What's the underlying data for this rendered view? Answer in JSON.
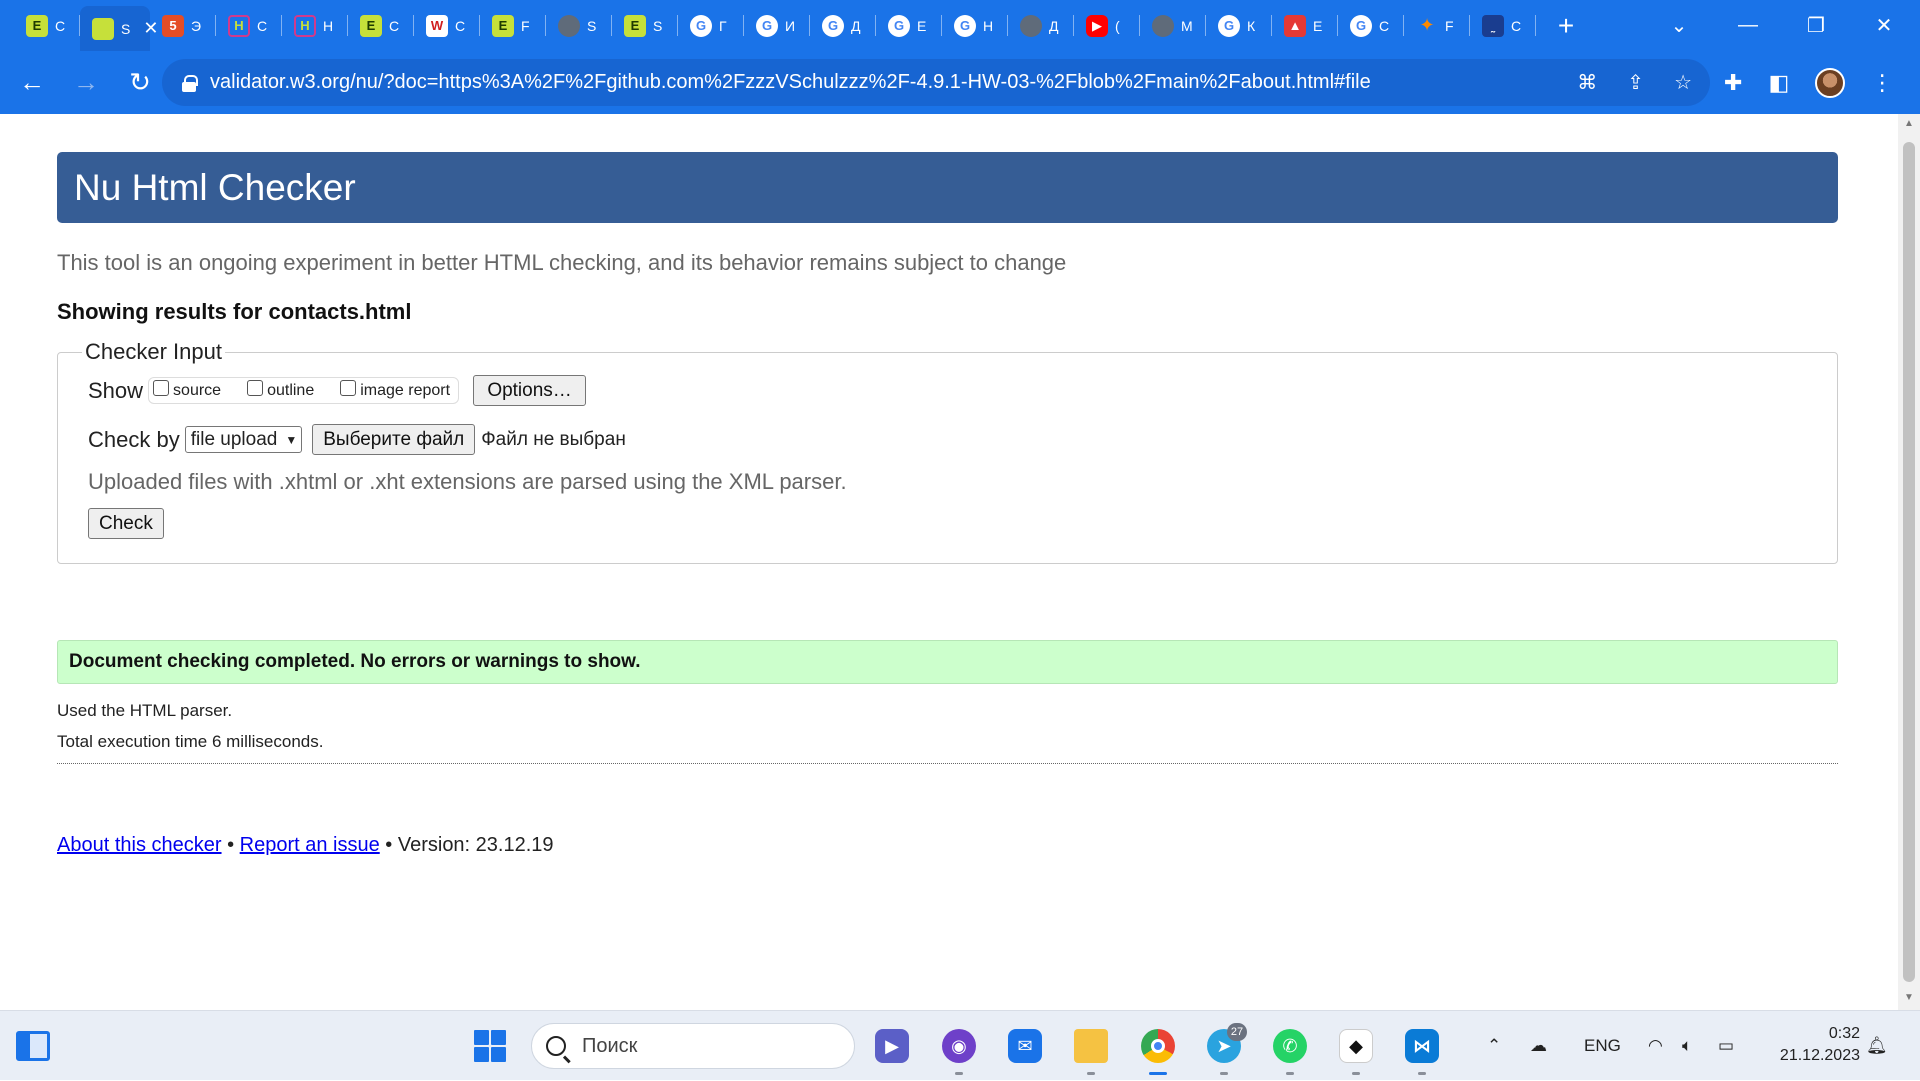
{
  "browser": {
    "tabs": [
      {
        "icon": "yellow-green-square-icon",
        "glyph": "E",
        "text": "С",
        "active": false
      },
      {
        "icon": "yellow-green-square-icon",
        "glyph": "",
        "text": "S",
        "active": true
      },
      {
        "icon": "html5-icon",
        "glyph": "5",
        "text": "Э",
        "active": false
      },
      {
        "icon": "htmlcademy-icon",
        "glyph": "H",
        "text": "С",
        "active": false
      },
      {
        "icon": "htmlcademy-icon",
        "glyph": "H",
        "text": "Н",
        "active": false
      },
      {
        "icon": "yellow-green-square-icon",
        "glyph": "E",
        "text": "С",
        "active": false
      },
      {
        "icon": "w3schools-icon",
        "glyph": "W",
        "text": "С",
        "active": false
      },
      {
        "icon": "yellow-green-square-icon",
        "glyph": "E",
        "text": "F",
        "active": false
      },
      {
        "icon": "globe-icon",
        "glyph": "",
        "text": "S",
        "active": false
      },
      {
        "icon": "yellow-green-square-icon",
        "glyph": "E",
        "text": "S",
        "active": false
      },
      {
        "icon": "google-icon",
        "glyph": "G",
        "text": "Г",
        "active": false
      },
      {
        "icon": "google-icon",
        "glyph": "G",
        "text": "И",
        "active": false
      },
      {
        "icon": "google-icon",
        "glyph": "G",
        "text": "Д",
        "active": false
      },
      {
        "icon": "google-icon",
        "glyph": "G",
        "text": "Е",
        "active": false
      },
      {
        "icon": "google-icon",
        "glyph": "G",
        "text": "Н",
        "active": false
      },
      {
        "icon": "globe-icon",
        "glyph": "",
        "text": "Д",
        "active": false
      },
      {
        "icon": "youtube-icon",
        "glyph": "▶",
        "text": "(",
        "active": false
      },
      {
        "icon": "globe-icon",
        "glyph": "",
        "text": "М",
        "active": false
      },
      {
        "icon": "google-icon",
        "glyph": "G",
        "text": "К",
        "active": false
      },
      {
        "icon": "red-profile-icon",
        "glyph": "▲",
        "text": "Е",
        "active": false
      },
      {
        "icon": "google-icon",
        "glyph": "G",
        "text": "С",
        "active": false
      },
      {
        "icon": "fox-icon",
        "glyph": "✦",
        "text": "F",
        "active": false
      },
      {
        "icon": "dark-blue-icon",
        "glyph": "˷",
        "text": "С",
        "active": false
      }
    ],
    "url": "validator.w3.org/nu/?doc=https%3A%2F%2Fgithub.com%2FzzzVSchulzzz%2F-4.9.1-HW-03-%2Fblob%2Fmain%2Fabout.html#file"
  },
  "page": {
    "title": "Nu Html Checker",
    "tagline": "This tool is an ongoing experiment in better HTML checking, and its behavior remains subject to change",
    "showing": "Showing results for contacts.html",
    "checker": {
      "legend": "Checker Input",
      "show_label": "Show",
      "options": [
        {
          "label": "source",
          "checked": false
        },
        {
          "label": "outline",
          "checked": false
        },
        {
          "label": "image report",
          "checked": false
        }
      ],
      "options_button": "Options…",
      "check_by_label": "Check by",
      "check_by_value": "file upload",
      "choose_file_button": "Выберите файл",
      "no_file_text": "Файл не выбран",
      "hint": "Uploaded files with .xhtml or .xht extensions are parsed using the XML parser.",
      "check_button": "Check"
    },
    "result": {
      "message": "Document checking completed. No errors or warnings to show.",
      "parser": "Used the HTML parser.",
      "time": "Total execution time 6 milliseconds."
    },
    "footer": {
      "about": "About this checker",
      "sep1": " • ",
      "report": "Report an issue",
      "version": " • Version: 23.12.19"
    }
  },
  "taskbar": {
    "search_placeholder": "Поиск",
    "telegram_badge": "27",
    "language": "ENG",
    "time": "0:32",
    "date": "21.12.2023"
  },
  "colors": {
    "browser_accent": "#1a73e8",
    "banner": "#365d95",
    "success_bg": "#ccffcc"
  }
}
